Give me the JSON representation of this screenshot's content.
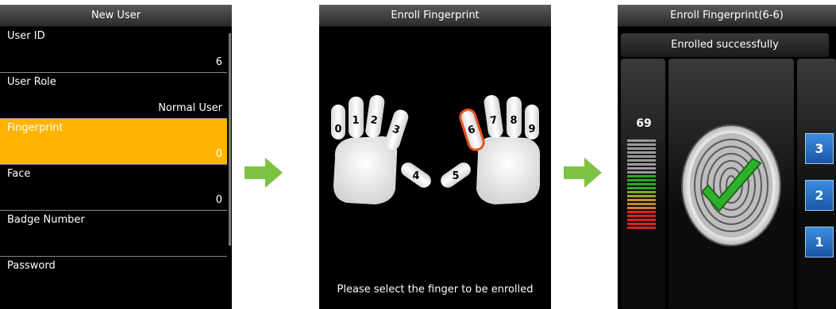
{
  "panel1": {
    "title": "New User",
    "items": [
      {
        "label": "User ID",
        "value": "6"
      },
      {
        "label": "User Role",
        "value": "Normal User"
      },
      {
        "label": "Fingerprint",
        "value": "0"
      },
      {
        "label": "Face",
        "value": "0"
      },
      {
        "label": "Badge Number",
        "value": ""
      },
      {
        "label": "Password",
        "value": ""
      }
    ],
    "selected_index": 2
  },
  "panel2": {
    "title": "Enroll Fingerprint",
    "fingers": [
      "0",
      "1",
      "2",
      "3",
      "4",
      "5",
      "6",
      "7",
      "8",
      "9"
    ],
    "selected_finger": "6",
    "prompt": "Please select the finger to be enrolled"
  },
  "panel3": {
    "title": "Enroll Fingerprint(6-6)",
    "status": "Enrolled successfully",
    "quality": "69",
    "steps": [
      "3",
      "2",
      "1"
    ]
  },
  "colors": {
    "selected_row": "#ffb400",
    "arrow": "#7dc243",
    "finger_highlight": "#e8531f",
    "step_blue": "#1a55a8"
  }
}
